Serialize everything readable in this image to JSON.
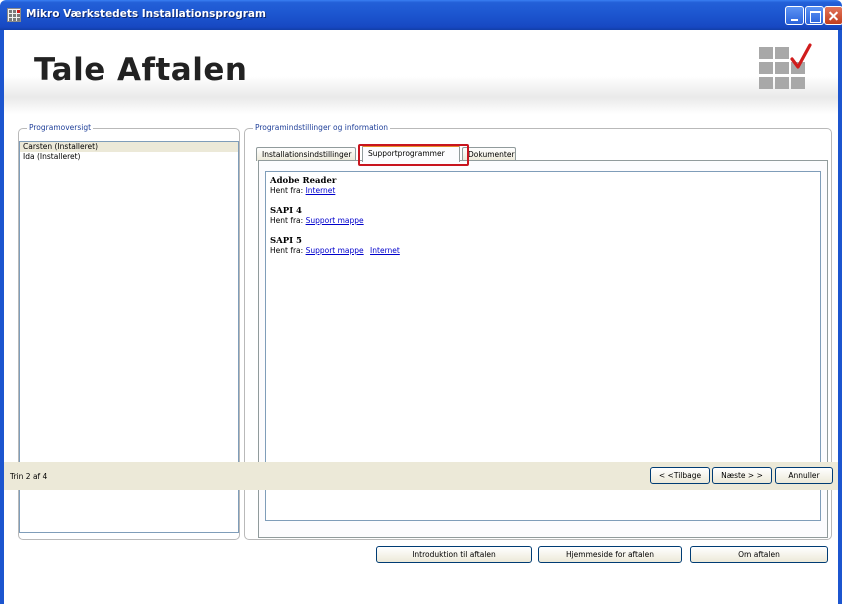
{
  "window": {
    "title": "Mikro Værkstedets Installationsprogram"
  },
  "header": {
    "title": "Tale Aftalen"
  },
  "program_overview": {
    "legend": "Programoversigt",
    "items": [
      {
        "label": "Carsten (Installeret)",
        "selected": true
      },
      {
        "label": "Ida (Installeret)",
        "selected": false
      }
    ]
  },
  "settings": {
    "legend": "Programindstillinger og information",
    "tabs": [
      {
        "label": "Installationsindstillinger",
        "active": false
      },
      {
        "label": "Supportprogrammer",
        "active": true
      },
      {
        "label": "Dokumenter",
        "active": false
      }
    ],
    "programs": [
      {
        "name": "Adobe Reader",
        "fetch_label": "Hent fra:",
        "links": [
          "Internet"
        ]
      },
      {
        "name": "SAPI 4",
        "fetch_label": "Hent fra:",
        "links": [
          "Support mappe"
        ]
      },
      {
        "name": "SAPI 5",
        "fetch_label": "Hent fra:",
        "links": [
          "Support mappe",
          "Internet"
        ]
      }
    ]
  },
  "actions": {
    "intro": "Introduktion til aftalen",
    "homepage": "Hjemmeside for aftalen",
    "about": "Om aftalen"
  },
  "footer": {
    "step": "Trin 2 af 4",
    "back": "< <Tilbage",
    "next": "Næste > >",
    "cancel": "Annuller"
  },
  "colors": {
    "titlebar": "#1c55cf",
    "highlight": "#c8141e",
    "link": "#0000cc",
    "legend": "#1f3f99"
  }
}
